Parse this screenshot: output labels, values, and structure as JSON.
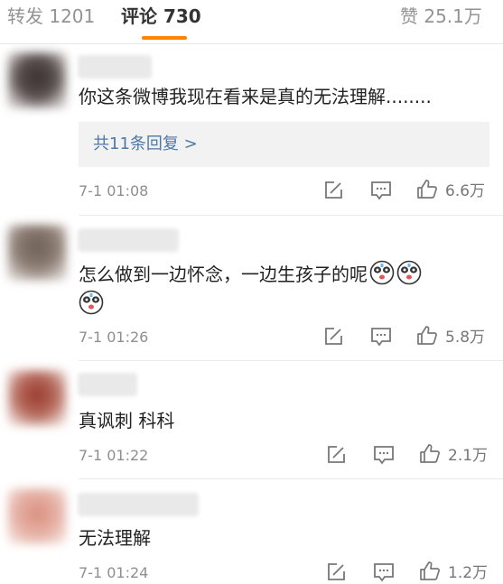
{
  "tabs": {
    "repost": "转发 1201",
    "comment": "评论 730",
    "like": "赞 25.1万"
  },
  "colors": {
    "accent": "#ff8200",
    "link": "#4d78a8"
  },
  "comments": [
    {
      "text": "你这条微博我现在看来是真的无法理解........",
      "replies": "共11条回复 >",
      "time": "7-1 01:08",
      "likes": "6.6万"
    },
    {
      "text": "怎么做到一边怀念，一边生孩子的呢",
      "emoji": "panda-face-icon",
      "time": "7-1 01:26",
      "likes": "5.8万"
    },
    {
      "text": "真讽刺 科科",
      "time": "7-1 01:22",
      "likes": "2.1万"
    },
    {
      "text": "无法理解",
      "time": "7-1 01:24",
      "likes": "1.2万"
    }
  ]
}
